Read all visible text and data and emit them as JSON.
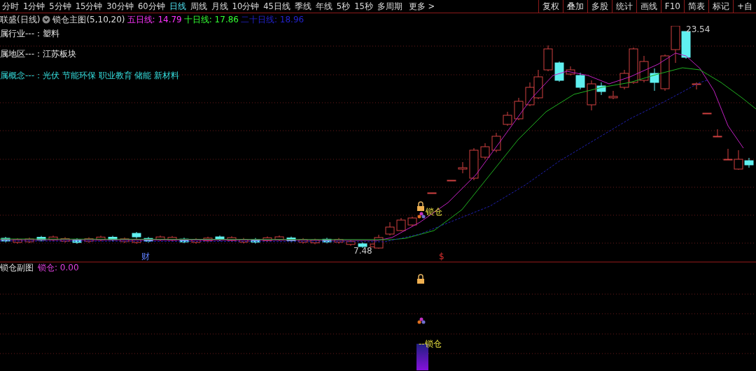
{
  "toolbar": {
    "periods": [
      {
        "label": "分时",
        "selected": false
      },
      {
        "label": "1分钟",
        "selected": false
      },
      {
        "label": "5分钟",
        "selected": false
      },
      {
        "label": "15分钟",
        "selected": false
      },
      {
        "label": "30分钟",
        "selected": false
      },
      {
        "label": "60分钟",
        "selected": false
      },
      {
        "label": "日线",
        "selected": true
      },
      {
        "label": "周线",
        "selected": false
      },
      {
        "label": "月线",
        "selected": false
      },
      {
        "label": "10分钟",
        "selected": false
      },
      {
        "label": "45日线",
        "selected": false
      },
      {
        "label": "季线",
        "selected": false
      },
      {
        "label": "年线",
        "selected": false
      },
      {
        "label": "5秒",
        "selected": false
      },
      {
        "label": "15秒",
        "selected": false
      },
      {
        "label": "多周期",
        "selected": false
      }
    ],
    "more": "更多 >",
    "actions": [
      "复权",
      "叠加",
      "多股",
      "统计",
      "画线",
      "F10",
      "简表",
      "标记",
      "+自"
    ]
  },
  "title_bar": {
    "stock": "联盛(日线)",
    "indicator": "锁仓主图(5,10,20)",
    "averages": [
      {
        "label": "五日线: 14.79",
        "color": "#ff33ff"
      },
      {
        "label": "十日线: 17.86",
        "color": "#33ff33"
      },
      {
        "label": "二十日线: 18.96",
        "color": "#2222cc"
      }
    ]
  },
  "info": [
    {
      "text": "属行业---：塑料",
      "highlighted": false
    },
    {
      "text": "属地区---：江苏板块",
      "highlighted": false
    },
    {
      "text": "属概念---：光伏 节能环保 职业教育 储能 新材料",
      "highlighted": true
    }
  ],
  "chart_labels": {
    "high": "23.54",
    "low": "7.48",
    "lock": "锁仓",
    "finance": "财",
    "dividend": "$"
  },
  "sub_chart": {
    "title": "锁仓副图",
    "value": "锁仓: 0.00",
    "label": "--锁仓"
  }
}
